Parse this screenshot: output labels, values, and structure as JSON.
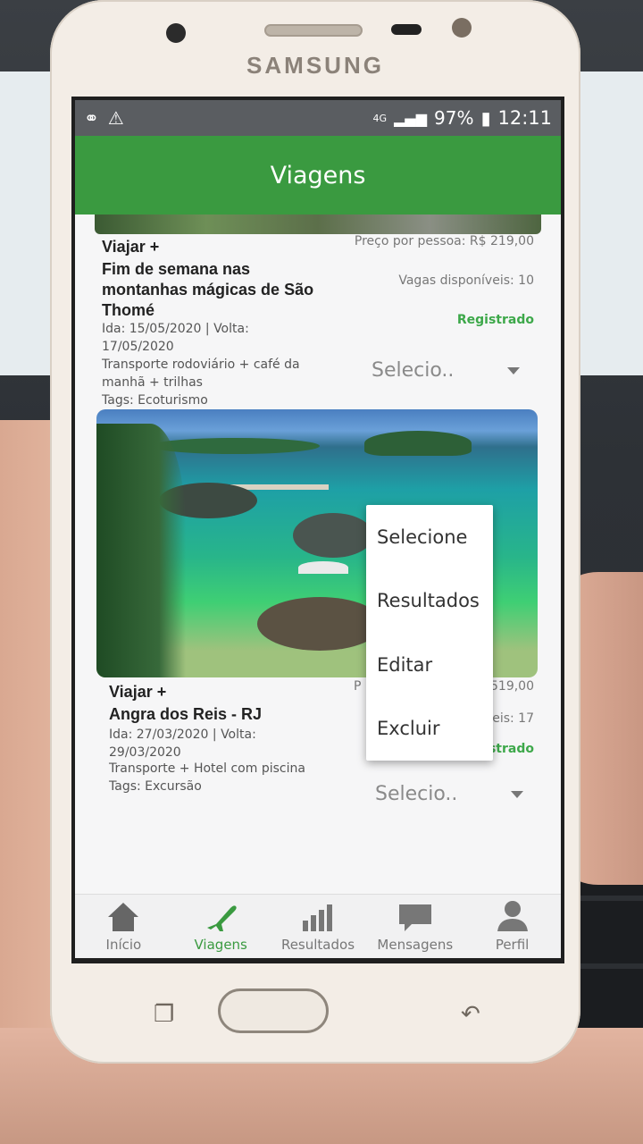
{
  "device": {
    "brand": "SAMSUNG"
  },
  "status_bar": {
    "network": "4G",
    "battery": "97%",
    "time": "12:11"
  },
  "app_bar": {
    "title": "Viagens"
  },
  "cards": [
    {
      "kicker": "Viajar +",
      "title": "Fim de semana nas montanhas mágicas de São Thomé",
      "price": "Preço por pessoa: R$ 219,00",
      "vacancies": "Vagas disponíveis: 10",
      "status": "Registrado",
      "dates": "Ida: 15/05/2020 | Volta: 17/05/2020",
      "description": "Transporte rodoviário + café da manhã + trilhas",
      "tags": "Tags: Ecoturismo",
      "select_value": "Selecio.."
    },
    {
      "kicker": "Viajar +",
      "title": "Angra dos Reis - RJ",
      "price_partial_left": "P",
      "price_partial_right": "519,00",
      "vacancies_partial": "veis: 17",
      "status_partial": "strado",
      "dates": "Ida: 27/03/2020 | Volta: 29/03/2020",
      "description": "Transporte + Hotel com piscina",
      "tags": "Tags: Excursão",
      "select_value": "Selecio.."
    }
  ],
  "dropdown_menu": {
    "options": [
      "Selecione",
      "Resultados",
      "Editar",
      "Excluir"
    ]
  },
  "tab_bar": {
    "tabs": [
      {
        "label": "Início",
        "icon": "home-icon"
      },
      {
        "label": "Viagens",
        "icon": "airplane-icon",
        "active": true
      },
      {
        "label": "Resultados",
        "icon": "bar-chart-icon"
      },
      {
        "label": "Mensagens",
        "icon": "message-icon"
      },
      {
        "label": "Perfil",
        "icon": "profile-icon"
      }
    ]
  },
  "colors": {
    "primary": "#3a9a40",
    "registered": "#3da84a"
  }
}
